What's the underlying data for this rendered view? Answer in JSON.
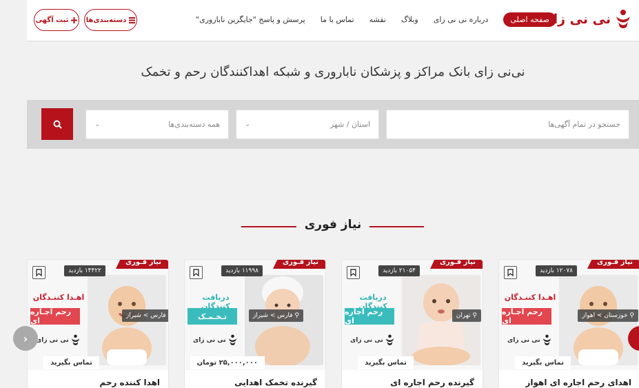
{
  "header": {
    "logo_text": "نی نی زای",
    "nav": [
      {
        "label": "صفحه اصلی",
        "active": true
      },
      {
        "label": "درباره نی نی زای"
      },
      {
        "label": "وبلاگ"
      },
      {
        "label": "نقشه"
      },
      {
        "label": "تماس با ما"
      },
      {
        "label": "پرسش و پاسخ \"جایگزین ناباروری\""
      }
    ],
    "categories_btn": "دسته‌بندی‌ها",
    "post_ad_btn": "ثبت آگهی"
  },
  "tagline": "نی‌نی زای بانک مراکز و پزشکان ناباروری و شبکه اهداکنندگان رحم و تخمک",
  "search": {
    "query_placeholder": "جستجو در تمام آگهی‌ها",
    "location_placeholder": "استان / شهر",
    "category_placeholder": "همه دسته‌بندی‌ها"
  },
  "section_title": "نیاز فوری",
  "badge": "نیاز فـوری",
  "logo_mini": "نی نی زای",
  "cards": [
    {
      "views": "۱۲۰۷۸ بازدید",
      "location": "خوزستان > اهواز",
      "line1": "اهـدا کننـدگان",
      "line2": "رحم اجـاره ای",
      "line1_color": "#c8202e",
      "line2_bg": "#e2464e",
      "price": "تماس بگیرید",
      "title": "اهدای رحم اجاره ای اهواز"
    },
    {
      "views": "۲۱۰۵۴ بازدید",
      "location": "تهران",
      "line1": "دریافت کنندگان",
      "line2": "رحم اجاره ای",
      "line1_color": "#2fb4b4",
      "line2_bg": "#3bbcbc",
      "price": "تماس بگیرید",
      "title": "گیرنده رحم اجاره ای"
    },
    {
      "views": "۱۱۹۹۸ بازدید",
      "location": "فارس > شیراز",
      "line1": "دریافت کنندگان",
      "line2": "تـخـمـک",
      "line1_color": "#2fb4b4",
      "line2_bg": "#3bbcbc",
      "price": "۲۵,۰۰۰,۰۰۰ تومان",
      "title": "گیرنده تخمک اهدایی"
    },
    {
      "views": "۱۴۴۲۲ بازدید",
      "location": "فارس > شیراز",
      "line1": "اهـدا کننـدگان",
      "line2": "رحم اجـاره ای",
      "line1_color": "#c8202e",
      "line2_bg": "#e2464e",
      "price": "تماس بگیرید",
      "title": "اهدا کننده رحم"
    }
  ],
  "colors": {
    "brand": "#b5121b",
    "search_bg": "#d6d6d6"
  }
}
